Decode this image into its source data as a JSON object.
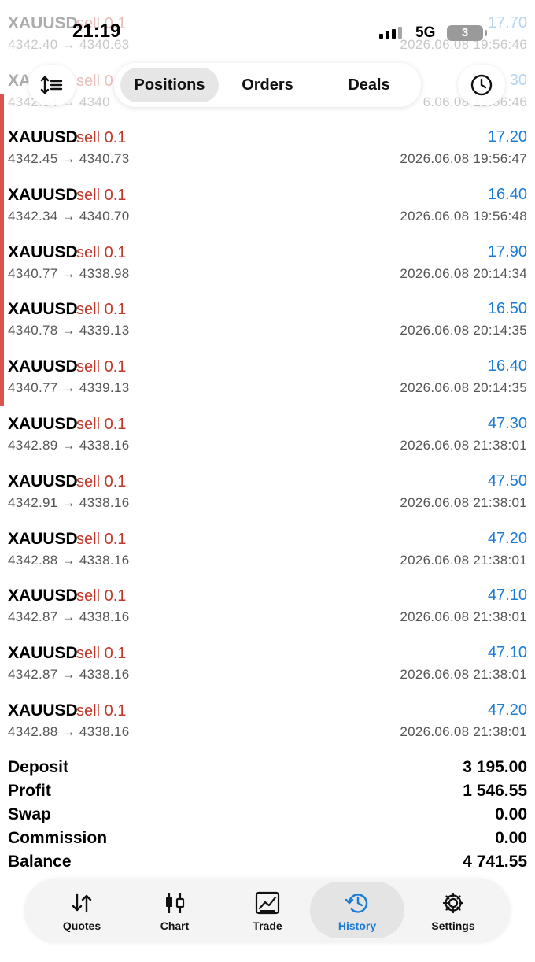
{
  "status": {
    "time": "21:19",
    "network": "5G",
    "battery": "3"
  },
  "header": {
    "tabs": [
      {
        "label": "Positions",
        "active": true
      },
      {
        "label": "Orders",
        "active": false
      },
      {
        "label": "Deals",
        "active": false
      }
    ]
  },
  "ghost_rows": [
    {
      "symbol": "XAUUSD",
      "side": "sell 0.1",
      "profit": "17.70",
      "prices": "4342.40 → 4340.63",
      "time": "2026.06.08 19:56:46"
    },
    {
      "symbol": "XA",
      "side": "sell 0",
      "profit": "30",
      "prices": "4342.54 → 4340",
      "time": "6.06.08 19:56:46"
    }
  ],
  "deals": [
    {
      "symbol": "XAUUSD",
      "side": "sell 0.1",
      "profit": "17.20",
      "prices": "4342.45 → 4340.73",
      "time": "2026.06.08 19:56:47"
    },
    {
      "symbol": "XAUUSD",
      "side": "sell 0.1",
      "profit": "16.40",
      "prices": "4342.34 → 4340.70",
      "time": "2026.06.08 19:56:48"
    },
    {
      "symbol": "XAUUSD",
      "side": "sell 0.1",
      "profit": "17.90",
      "prices": "4340.77 → 4338.98",
      "time": "2026.06.08 20:14:34"
    },
    {
      "symbol": "XAUUSD",
      "side": "sell 0.1",
      "profit": "16.50",
      "prices": "4340.78 → 4339.13",
      "time": "2026.06.08 20:14:35"
    },
    {
      "symbol": "XAUUSD",
      "side": "sell 0.1",
      "profit": "16.40",
      "prices": "4340.77 → 4339.13",
      "time": "2026.06.08 20:14:35"
    },
    {
      "symbol": "XAUUSD",
      "side": "sell 0.1",
      "profit": "47.30",
      "prices": "4342.89 → 4338.16",
      "time": "2026.06.08 21:38:01"
    },
    {
      "symbol": "XAUUSD",
      "side": "sell 0.1",
      "profit": "47.50",
      "prices": "4342.91 → 4338.16",
      "time": "2026.06.08 21:38:01"
    },
    {
      "symbol": "XAUUSD",
      "side": "sell 0.1",
      "profit": "47.20",
      "prices": "4342.88 → 4338.16",
      "time": "2026.06.08 21:38:01"
    },
    {
      "symbol": "XAUUSD",
      "side": "sell 0.1",
      "profit": "47.10",
      "prices": "4342.87 → 4338.16",
      "time": "2026.06.08 21:38:01"
    },
    {
      "symbol": "XAUUSD",
      "side": "sell 0.1",
      "profit": "47.10",
      "prices": "4342.87 → 4338.16",
      "time": "2026.06.08 21:38:01"
    },
    {
      "symbol": "XAUUSD",
      "side": "sell 0.1",
      "profit": "47.20",
      "prices": "4342.88 → 4338.16",
      "time": "2026.06.08 21:38:01"
    }
  ],
  "summary": [
    {
      "label": "Deposit",
      "value": "3 195.00"
    },
    {
      "label": "Profit",
      "value": "1 546.55"
    },
    {
      "label": "Swap",
      "value": "0.00"
    },
    {
      "label": "Commission",
      "value": "0.00"
    },
    {
      "label": "Balance",
      "value": "4 741.55"
    }
  ],
  "bottom_nav": [
    {
      "label": "Quotes",
      "icon": "quotes-arrows-icon",
      "active": false
    },
    {
      "label": "Chart",
      "icon": "candlestick-icon",
      "active": false
    },
    {
      "label": "Trade",
      "icon": "trade-chart-icon",
      "active": false
    },
    {
      "label": "History",
      "icon": "history-clock-icon",
      "active": true
    },
    {
      "label": "Settings",
      "icon": "gear-icon",
      "active": false
    }
  ],
  "colors": {
    "sell": "#c0392b",
    "profit": "#1a7bd6",
    "accent_bar": "#d9534f",
    "active_nav": "#1a7bd6"
  }
}
